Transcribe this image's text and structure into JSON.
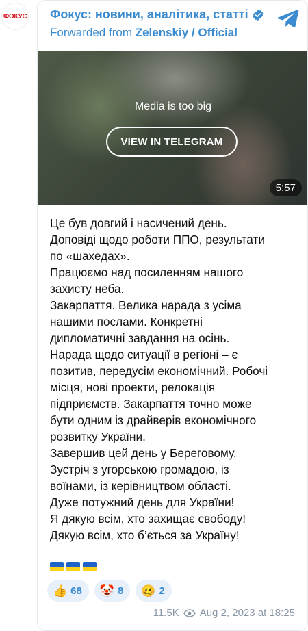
{
  "avatar": {
    "text": "ФОКУС",
    "color": "#d91c23"
  },
  "header": {
    "channel_name": "Фокус: новини, аналітика, статті",
    "forwarded_prefix": "Forwarded from ",
    "forwarded_source": "Zelenskiy / Official",
    "verified_icon": "verified-check-icon",
    "logo_icon": "telegram-logo-icon"
  },
  "media": {
    "note": "Media is too big",
    "button_label": "VIEW IN TELEGRAM",
    "duration": "5:57"
  },
  "post": {
    "lines": [
      "Це був довгий і насичений день.",
      "Доповіді щодо роботи ППО, результати",
      "по «шахедах».",
      "Працюємо над посиленням нашого",
      "захисту неба.",
      "Закарпаття. Велика нарада з усіма",
      "нашими послами. Конкретні",
      "дипломатичні завдання на осінь.",
      "Нарада щодо ситуації в регіоні – є",
      "позитив, передусім економічний. Робочі",
      "місця, нові проекти, релокація",
      "підприємств. Закарпаття точно може",
      "бути одним із драйверів економічного",
      "розвитку України.",
      "Завершив цей день у Береговому.",
      "Зустріч з угорською громадою, із",
      "воїнами, із керівництвом області.",
      "Дуже потужний день для України!",
      "Я дякую всім, хто захищає свободу!",
      "Дякую всім, хто б’ється за Україну!"
    ],
    "flags": [
      "ukraine-flag",
      "ukraine-flag",
      "ukraine-flag"
    ]
  },
  "reactions": [
    {
      "emoji": "👍",
      "count": "68"
    },
    {
      "emoji": "🤡",
      "count": "8"
    },
    {
      "emoji": "🥴",
      "count": "2"
    }
  ],
  "meta": {
    "views": "11.5K",
    "date": "Aug 2, 2023 at 18:25"
  },
  "colors": {
    "accent": "#3b8bd0",
    "reaction_bg": "#e8f1fb",
    "meta": "#8a97a5"
  }
}
